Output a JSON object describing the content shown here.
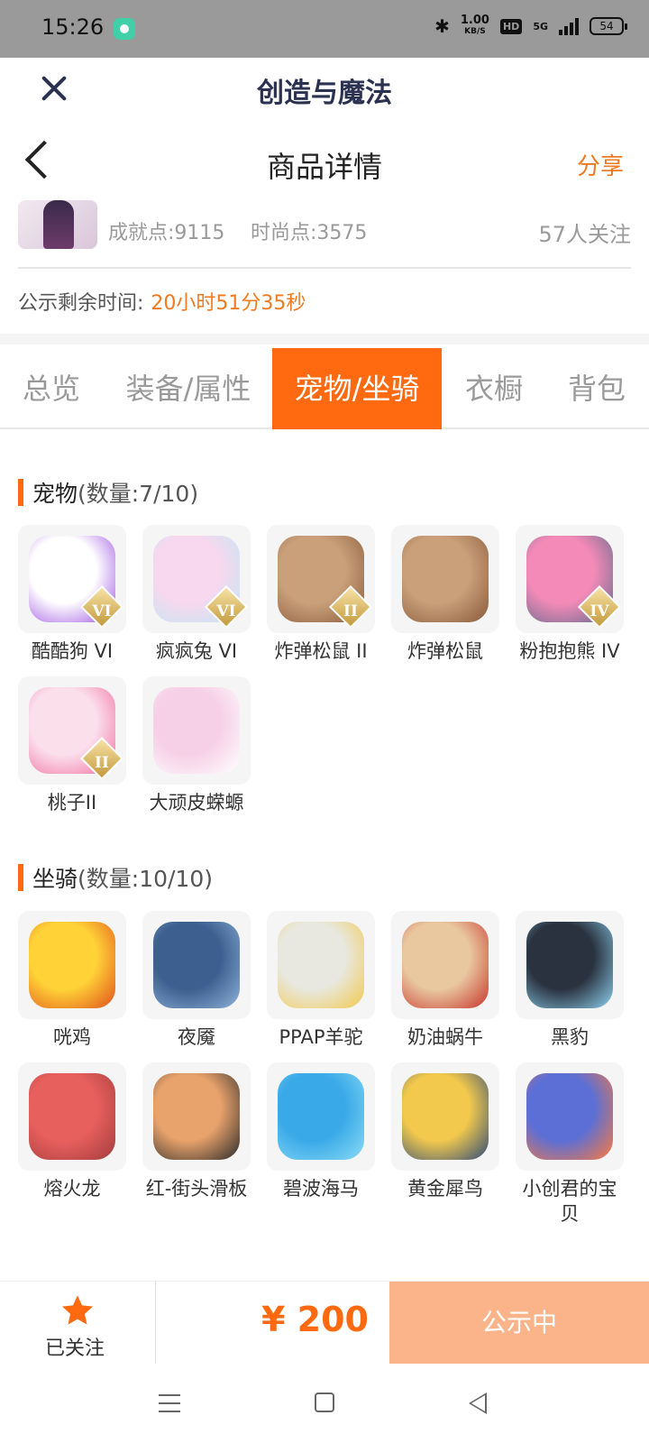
{
  "status_bar": {
    "time": "15:26",
    "net_speed": "1.00",
    "net_unit": "KB/S",
    "hd": "HD",
    "signal": "5G",
    "battery": "54"
  },
  "app_header": {
    "title": "创造与魔法"
  },
  "page_header": {
    "title": "商品详情",
    "share_label": "分享"
  },
  "seller": {
    "achievement": "成就点:9115",
    "fashion": "时尚点:3575",
    "followers": "57人关注"
  },
  "remaining": {
    "label": "公示剩余时间:",
    "value": "20小时51分35秒"
  },
  "tabs": [
    {
      "label": "总览",
      "active": false
    },
    {
      "label": "装备/属性",
      "active": false
    },
    {
      "label": "宠物/坐骑",
      "active": true
    },
    {
      "label": "衣橱",
      "active": false
    },
    {
      "label": "背包",
      "active": false
    }
  ],
  "pets": {
    "title": "宠物",
    "count": "(数量:7/10)",
    "items": [
      {
        "name": "酷酷狗 VI",
        "badge": "VI",
        "color": "#ffffff",
        "accent": "#9a4de0"
      },
      {
        "name": "疯疯兔 VI",
        "badge": "VI",
        "color": "#f7d8ee",
        "accent": "#bfe8f5"
      },
      {
        "name": "炸弹松鼠 II",
        "badge": "II",
        "color": "#c9a07a",
        "accent": "#8a5a3a"
      },
      {
        "name": "炸弹松鼠",
        "badge": "",
        "color": "#c9a07a",
        "accent": "#8a5a3a"
      },
      {
        "name": "粉抱抱熊 IV",
        "badge": "IV",
        "color": "#f48ab8",
        "accent": "#5a6a8a"
      },
      {
        "name": "桃子II",
        "badge": "II",
        "color": "#fbe0ec",
        "accent": "#f06a9a"
      },
      {
        "name": "大顽皮蝾螈",
        "badge": "",
        "color": "#f6d0e6",
        "accent": "#ffffff"
      }
    ]
  },
  "mounts": {
    "title": "坐骑",
    "count": "(数量:10/10)",
    "items": [
      {
        "name": "咣鸡",
        "color": "#ffd338",
        "accent": "#e0501a"
      },
      {
        "name": "夜魇",
        "color": "#3c5f8f",
        "accent": "#8fb3d9"
      },
      {
        "name": "PPAP羊驼",
        "color": "#e8e8e0",
        "accent": "#f2c94c"
      },
      {
        "name": "奶油蜗牛",
        "color": "#e9c8a0",
        "accent": "#c7342b"
      },
      {
        "name": "黑豹",
        "color": "#2a3240",
        "accent": "#8fd3f0"
      },
      {
        "name": "熔火龙",
        "color": "#e8605e",
        "accent": "#a33c3c"
      },
      {
        "name": "红-街头滑板",
        "color": "#e8a26b",
        "accent": "#2a2a2a"
      },
      {
        "name": "碧波海马",
        "color": "#3aa9e8",
        "accent": "#8adcf5"
      },
      {
        "name": "黄金犀鸟",
        "color": "#f2c94c",
        "accent": "#2d4a7a"
      },
      {
        "name": "小创君的宝贝",
        "color": "#5b6fd6",
        "accent": "#ff7a3a"
      }
    ]
  },
  "bottom": {
    "followed_label": "已关注",
    "price": "¥ 200",
    "status_label": "公示中"
  },
  "colors": {
    "accent": "#ff6a11",
    "accent_light": "#fbb48a",
    "title_dark": "#2b3150"
  }
}
